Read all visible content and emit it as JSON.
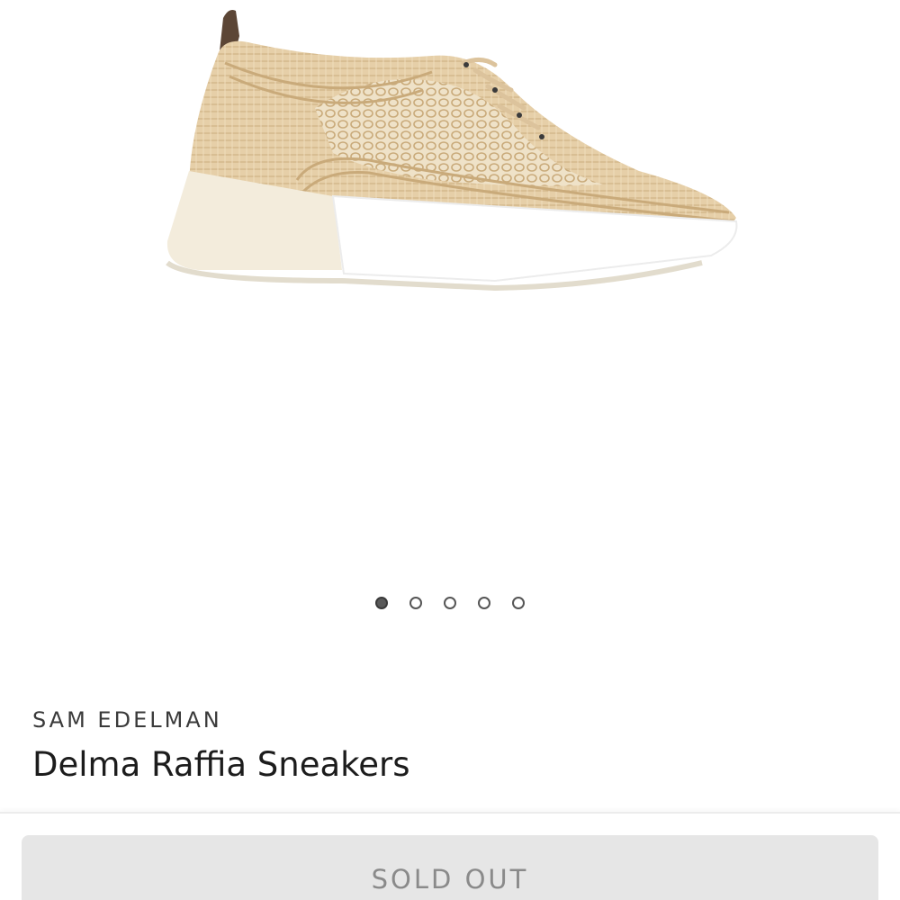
{
  "product": {
    "brand": "SAM EDELMAN",
    "name": "Delma Raffia Sneakers",
    "image_alt": "Delma Raffia Sneakers product image"
  },
  "gallery": {
    "total_images": 5,
    "active_index": 0
  },
  "actions": {
    "sold_out_label": "SOLD OUT"
  },
  "colors": {
    "raffia": "#e4cfac",
    "sole": "#f3ecdc",
    "button_bg": "#e6e6e6",
    "button_text": "#8a8a8a"
  }
}
